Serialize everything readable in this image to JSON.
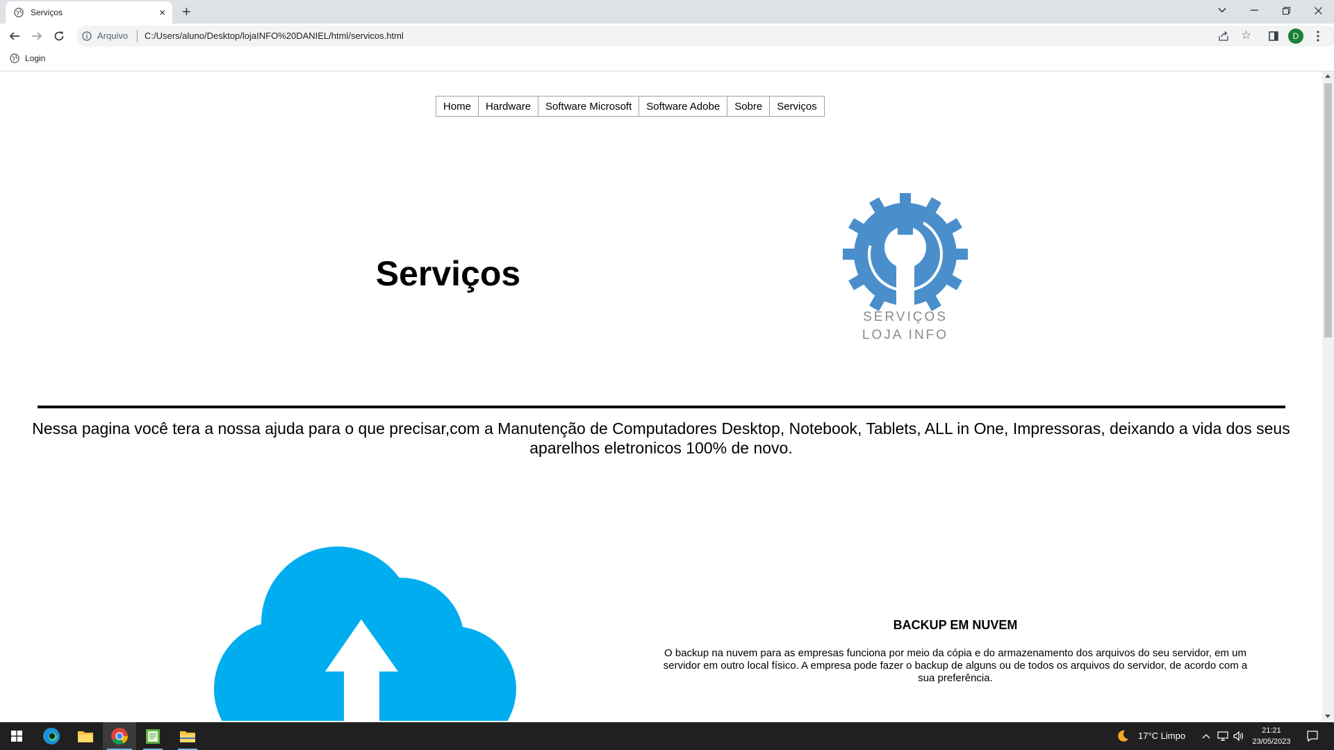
{
  "browser": {
    "tab_title": "Serviços",
    "new_tab_symbol": "+",
    "close_symbol": "×",
    "scheme_label": "Arquivo",
    "url": "C:/Users/aluno/Desktop/lojaINFO%20DANIEL/html/servicos.html",
    "profile_initial": "D",
    "bookmark_label": "Login",
    "icons": [
      "back-icon",
      "forward-icon",
      "reload-icon",
      "info-icon",
      "share-icon",
      "star-icon",
      "side-panel-icon",
      "menu-icon",
      "tab-search-icon"
    ]
  },
  "nav": {
    "items": [
      "Home",
      "Hardware",
      "Software Microsoft",
      "Software Adobe",
      "Sobre",
      "Serviços"
    ]
  },
  "hero": {
    "title": "Serviços",
    "logo_line1": "SERVIÇOS",
    "logo_line2": "LOJA INFO"
  },
  "intro": {
    "text": "Nessa pagina você tera a nossa ajuda para o que precisar,com a Manutenção de Computadores Desktop, Notebook, Tablets, ALL in One, Impressoras, deixando a vida dos seus aparelhos eletronicos 100% de novo."
  },
  "backup": {
    "title": "BACKUP EM NUVEM",
    "text": "O backup na nuvem para as empresas funciona por meio da cópia e do armazenamento dos arquivos do seu servidor, em um servidor em outro local físico. A empresa pode fazer o backup de alguns ou de todos os arquivos do servidor, de acordo com a sua preferência."
  },
  "taskbar": {
    "weather": "17°C  Limpo",
    "time": "21:21",
    "date": "23/05/2023"
  },
  "colors": {
    "gear_blue": "#4a8fcb",
    "cloud_blue": "#00aeef",
    "logo_text_gray": "#8a8a8a",
    "profile_green": "#188038"
  }
}
